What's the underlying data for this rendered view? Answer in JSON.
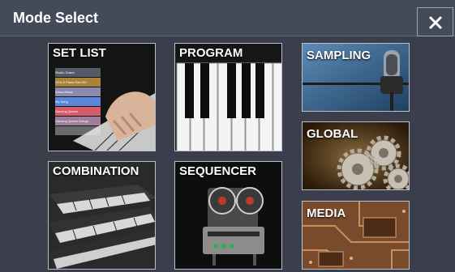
{
  "header": {
    "title": "Mode Select"
  },
  "modes": {
    "set_list": "SET LIST",
    "program": "PROGRAM",
    "sampling": "SAMPLING",
    "combination": "COMBINATION",
    "sequencer": "SEQUENCER",
    "global": "GLOBAL",
    "media": "MEDIA"
  },
  "set_list_slots": [
    {
      "number": "0",
      "name": "Studio Grand",
      "color": "#555b66"
    },
    {
      "number": "1",
      "name": "SGX-2 Piano Pad 001",
      "color": "#a8843a"
    },
    {
      "number": "2",
      "name": "Africa Brass",
      "color": "#8b8bb0"
    },
    {
      "number": "3",
      "name": "My Song",
      "color": "#5b86d8"
    },
    {
      "number": "4",
      "name": "Dancing Queen",
      "color": "#d65b6b"
    },
    {
      "number": "5",
      "name": "Dancing Queen Strings",
      "color": "#9c7d9a"
    },
    {
      "number": "6",
      "name": "",
      "color": "#777777"
    }
  ],
  "colors": {
    "background": "#3b3f4b",
    "titlebar": "#434a59",
    "tile_border": "#b8bfcc"
  }
}
